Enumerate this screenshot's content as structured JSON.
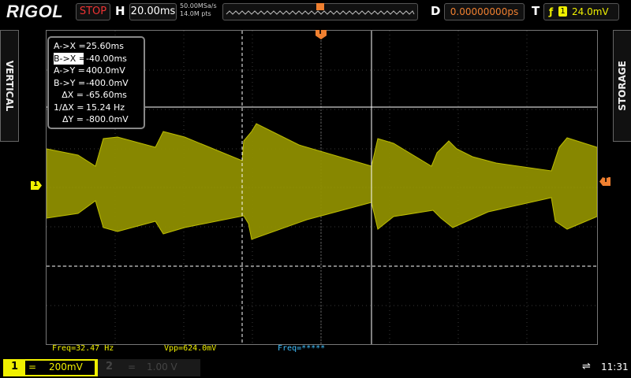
{
  "header": {
    "logo": "RIGOL",
    "run_state": "STOP",
    "horizontal_label": "H",
    "timebase": "20.00ms",
    "sample_rate": "50.00MSa/s",
    "memory_depth": "14.0M pts",
    "delay_label": "D",
    "delay": "0.00000000ps",
    "trigger_label": "T",
    "trigger_channel": "1",
    "trigger_level": "24.0mV"
  },
  "side_tabs": {
    "left": "VERTICAL",
    "right": "STORAGE"
  },
  "markers": {
    "trigger_top": "T",
    "ch1_marker": "1",
    "trigger_level_marker": "T"
  },
  "cursor_readout": [
    {
      "key": "A->X =",
      "value": "25.60ms",
      "highlight": false
    },
    {
      "key": "B->X =",
      "value": "-40.00ms",
      "highlight": true
    },
    {
      "key": "A->Y =",
      "value": "400.0mV",
      "highlight": false
    },
    {
      "key": "B->Y =",
      "value": "-400.0mV",
      "highlight": false
    },
    {
      "key": "ΔX =",
      "value": "-65.60ms",
      "highlight": false
    },
    {
      "key": "1/ΔX =",
      "value": "15.24 Hz",
      "highlight": false
    },
    {
      "key": "ΔY =",
      "value": "-800.0mV",
      "highlight": false
    }
  ],
  "measurements": {
    "freq": "Freq=32.47 Hz",
    "vpp": "Vpp=624.0mV",
    "freq2": "Freq=*****"
  },
  "footer": {
    "ch1_number": "1",
    "ch1_coupling": "=",
    "ch1_scale": "200mV",
    "ch2_number": "2",
    "ch2_coupling": "=",
    "ch2_scale": "1.00 V",
    "clock": "11:31"
  },
  "colors": {
    "ch1": "#f0f000",
    "trace": "#c8c800",
    "cursor": "#ffffff",
    "stop": "#e03030",
    "delay": "#f08030",
    "trigger_marker": "#f08030",
    "freq2": "#40c0ff"
  },
  "icons": [
    "edge-trigger-icon",
    "usb-icon",
    "trigger-marker-icon"
  ]
}
